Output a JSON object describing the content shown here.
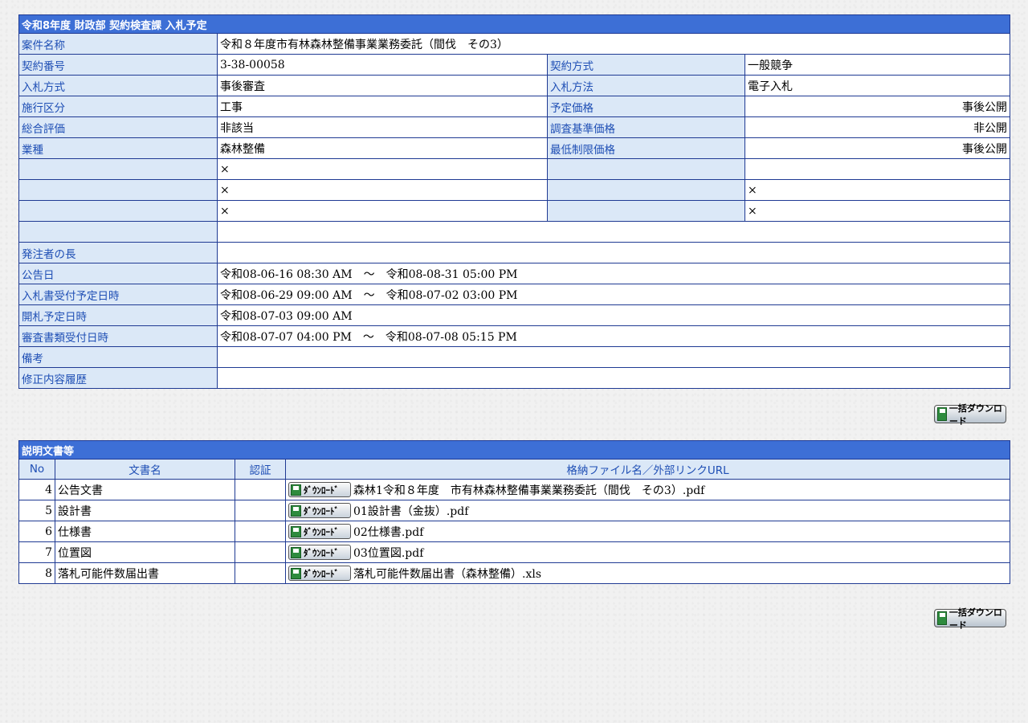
{
  "header": {
    "title": "令和8年度 財政部 契約検査課 入札予定"
  },
  "info": {
    "project_name_label": "案件名称",
    "project_name": "令和８年度市有林森林整備事業業務委託（間伐　その3）",
    "rows": [
      {
        "l1": "契約番号",
        "v1": "3-38-00058",
        "l2": "契約方式",
        "v2": "一般競争"
      },
      {
        "l1": "入札方式",
        "v1": "事後審査",
        "l2": "入札方法",
        "v2": "電子入札"
      },
      {
        "l1": "施行区分",
        "v1": "工事",
        "l2": "予定価格",
        "v2": "事後公開"
      },
      {
        "l1": "総合評価",
        "v1": "非該当",
        "l2": "調査基準価格",
        "v2": "非公開"
      },
      {
        "l1": "業種",
        "v1": "森林整備",
        "l2": "最低制限価格",
        "v2": "事後公開"
      },
      {
        "l1": "",
        "v1": "×",
        "l2": "",
        "v2": ""
      },
      {
        "l1": "",
        "v1": "×",
        "l2": "",
        "v2": "×"
      },
      {
        "l1": "",
        "v1": "×",
        "l2": "",
        "v2": "×"
      }
    ],
    "wide_rows": [
      {
        "label": "",
        "value": ""
      },
      {
        "label": "発注者の長",
        "value": ""
      },
      {
        "label": "公告日",
        "value": "令和08-06-16 08:30 AM　～　令和08-08-31 05:00 PM"
      },
      {
        "label": "入札書受付予定日時",
        "value": "令和08-06-29 09:00 AM　～　令和08-07-02 03:00 PM"
      },
      {
        "label": "開札予定日時",
        "value": "令和08-07-03 09:00 AM"
      },
      {
        "label": "審査書類受付日時",
        "value": "令和08-07-07 04:00 PM　～　令和08-07-08 05:15 PM"
      },
      {
        "label": "備考",
        "value": ""
      },
      {
        "label": "修正内容履歴",
        "value": ""
      }
    ]
  },
  "bulk_download_label": "一括ダウンロード",
  "documents": {
    "title": "説明文書等",
    "columns": {
      "no": "No",
      "name": "文書名",
      "cert": "認証",
      "file": "格納ファイル名／外部リンクURL"
    },
    "download_label": "ﾀﾞｳﾝﾛｰﾄﾞ",
    "rows": [
      {
        "no": "4",
        "name": "公告文書",
        "cert": "",
        "file": "森林1令和８年度　市有林森林整備事業業務委託（間伐　その3）.pdf"
      },
      {
        "no": "5",
        "name": "設計書",
        "cert": "",
        "file": "01設計書（金抜）.pdf"
      },
      {
        "no": "6",
        "name": "仕様書",
        "cert": "",
        "file": "02仕様書.pdf"
      },
      {
        "no": "7",
        "name": "位置図",
        "cert": "",
        "file": "03位置図.pdf"
      },
      {
        "no": "8",
        "name": "落札可能件数届出書",
        "cert": "",
        "file": "落札可能件数届出書（森林整備）.xls"
      }
    ]
  },
  "colors": {
    "title_bg": "#3d6fd6",
    "label_bg": "#dbe8f7",
    "label_text": "#1f4fb5",
    "border": "#1f3a93"
  }
}
